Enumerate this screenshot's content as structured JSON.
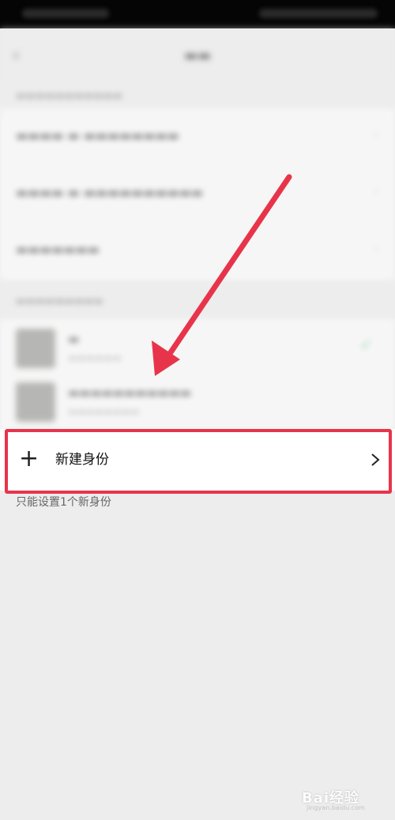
{
  "status_bar": {
    "background": "#050505"
  },
  "new_identity": {
    "label": "新建身份",
    "plus_icon": "+",
    "hint": "只能设置1个新身份"
  },
  "colors": {
    "highlight": "#e8344a",
    "background": "#ededed"
  },
  "watermark": {
    "text": "Bai经验",
    "sub": "jingyan.baidu.com"
  }
}
